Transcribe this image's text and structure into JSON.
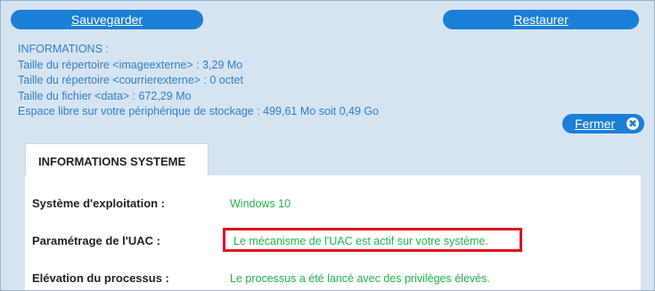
{
  "toolbar": {
    "save_label": "Sauvegarder",
    "restore_label": "Restaurer"
  },
  "info": {
    "heading": "INFORMATIONS :",
    "lines": [
      "Taille du répertoire <imageexterne> : 3,29 Mo",
      "Taille du répertoire <courrierexterne> : 0 octet",
      "Taille du fichier <data> : 672,29 Mo",
      "Espace libre sur votre périphérique de stockage : 499,61 Mo soit 0,49 Go"
    ]
  },
  "close_button": {
    "label": "Fermer",
    "icon": "close-icon"
  },
  "tab": {
    "label": "INFORMATIONS SYSTEME"
  },
  "system": [
    {
      "key": "Système d'exploitation :",
      "value": "Windows 10"
    },
    {
      "key": "Paramétrage de l'UAC :",
      "value": "Le mécanisme de l'UAC est actif sur votre système."
    },
    {
      "key": "Elévation du processus :",
      "value": "Le processus a été lancé avec des privilèges élevés."
    }
  ],
  "colors": {
    "accent": "#1a7fd6",
    "info_text": "#2a80c8",
    "ok_text": "#20b44a",
    "highlight": "#e0101a",
    "background": "#d6e4f2"
  }
}
